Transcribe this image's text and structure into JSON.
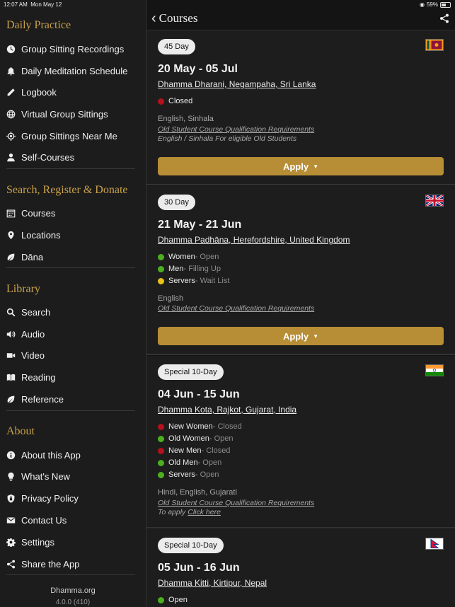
{
  "status_bar": {
    "time": "12:07 AM",
    "date": "Mon May 12",
    "battery": "59%"
  },
  "sidebar": {
    "sections": [
      {
        "title": "Daily Practice",
        "items": [
          {
            "label": "Group Sitting Recordings",
            "icon": "clock-icon"
          },
          {
            "label": "Daily Meditation Schedule",
            "icon": "bell-icon"
          },
          {
            "label": "Logbook",
            "icon": "pencil-icon"
          },
          {
            "label": "Virtual Group Sittings",
            "icon": "globe-icon"
          },
          {
            "label": "Group Sittings Near Me",
            "icon": "crosshair-icon"
          },
          {
            "label": "Self-Courses",
            "icon": "person-icon"
          }
        ]
      },
      {
        "title": "Search, Register & Donate",
        "items": [
          {
            "label": "Courses",
            "icon": "calendar-icon"
          },
          {
            "label": "Locations",
            "icon": "location-pin-icon"
          },
          {
            "label": "Dāna",
            "icon": "leaf-icon"
          }
        ]
      },
      {
        "title": "Library",
        "items": [
          {
            "label": "Search",
            "icon": "search-icon"
          },
          {
            "label": "Audio",
            "icon": "speaker-icon"
          },
          {
            "label": "Video",
            "icon": "video-camera-icon"
          },
          {
            "label": "Reading",
            "icon": "book-icon"
          },
          {
            "label": "Reference",
            "icon": "leaf-icon"
          }
        ]
      },
      {
        "title": "About",
        "items": [
          {
            "label": "About this App",
            "icon": "info-icon"
          },
          {
            "label": "What's New",
            "icon": "lightbulb-icon"
          },
          {
            "label": "Privacy Policy",
            "icon": "shield-lock-icon"
          },
          {
            "label": "Contact Us",
            "icon": "envelope-icon"
          },
          {
            "label": "Settings",
            "icon": "gear-icon"
          },
          {
            "label": "Share the App",
            "icon": "share-icon"
          }
        ]
      }
    ],
    "footer": {
      "name": "Dhamma.org",
      "version": "4.0.0 (410)"
    }
  },
  "header": {
    "title": "Courses"
  },
  "courses": [
    {
      "badge": "45 Day",
      "flag": "sri-lanka-flag-icon",
      "dates": "20 May - 05 Jul",
      "location": "Dhamma Dharani, Negampaha, Sri Lanka",
      "statuses": [
        {
          "label": "Closed",
          "detail": "",
          "color": "#b3121b"
        }
      ],
      "languages": "English, Sinhala",
      "requirements": "Old Student Course Qualification Requirements",
      "note": "English / Sinhala For eligible Old Students",
      "note_link": "",
      "apply": "Apply"
    },
    {
      "badge": "30 Day",
      "flag": "uk-flag-icon",
      "dates": "21 May - 21 Jun",
      "location": "Dhamma Padhāna, Herefordshire, United Kingdom",
      "statuses": [
        {
          "label": "Women",
          "detail": " - Open",
          "color": "#4caf1f"
        },
        {
          "label": "Men",
          "detail": " - Filling Up",
          "color": "#4caf1f"
        },
        {
          "label": "Servers",
          "detail": " - Wait List",
          "color": "#e8c21a"
        }
      ],
      "languages": "English",
      "requirements": "Old Student Course Qualification Requirements",
      "note": "",
      "note_link": "",
      "apply": "Apply"
    },
    {
      "badge": "Special 10-Day",
      "flag": "india-flag-icon",
      "dates": "04 Jun - 15 Jun",
      "location": "Dhamma Kota, Rajkot, Gujarat, India",
      "statuses": [
        {
          "label": "New Women",
          "detail": " - Closed",
          "color": "#b3121b"
        },
        {
          "label": "Old Women",
          "detail": " - Open",
          "color": "#4caf1f"
        },
        {
          "label": "New Men",
          "detail": " - Closed",
          "color": "#b3121b"
        },
        {
          "label": "Old Men",
          "detail": " - Open",
          "color": "#4caf1f"
        },
        {
          "label": "Servers",
          "detail": " - Open",
          "color": "#4caf1f"
        }
      ],
      "languages": "Hindi, English, Gujarati",
      "requirements": "Old Student Course Qualification Requirements",
      "note": "To apply ",
      "note_link": "Click here",
      "apply": ""
    },
    {
      "badge": "Special 10-Day",
      "flag": "nepal-flag-icon",
      "dates": "05 Jun - 16 Jun",
      "location": "Dhamma Kitti, Kirtipur, Nepal",
      "statuses": [
        {
          "label": "Open",
          "detail": "",
          "color": "#4caf1f"
        }
      ],
      "languages": "",
      "requirements": "",
      "note": "",
      "note_link": "",
      "apply": ""
    }
  ],
  "colors": {
    "accent": "#c9a14a",
    "apply_button": "#b78e35",
    "open": "#4caf1f",
    "closed": "#b3121b",
    "waitlist": "#e8c21a"
  }
}
